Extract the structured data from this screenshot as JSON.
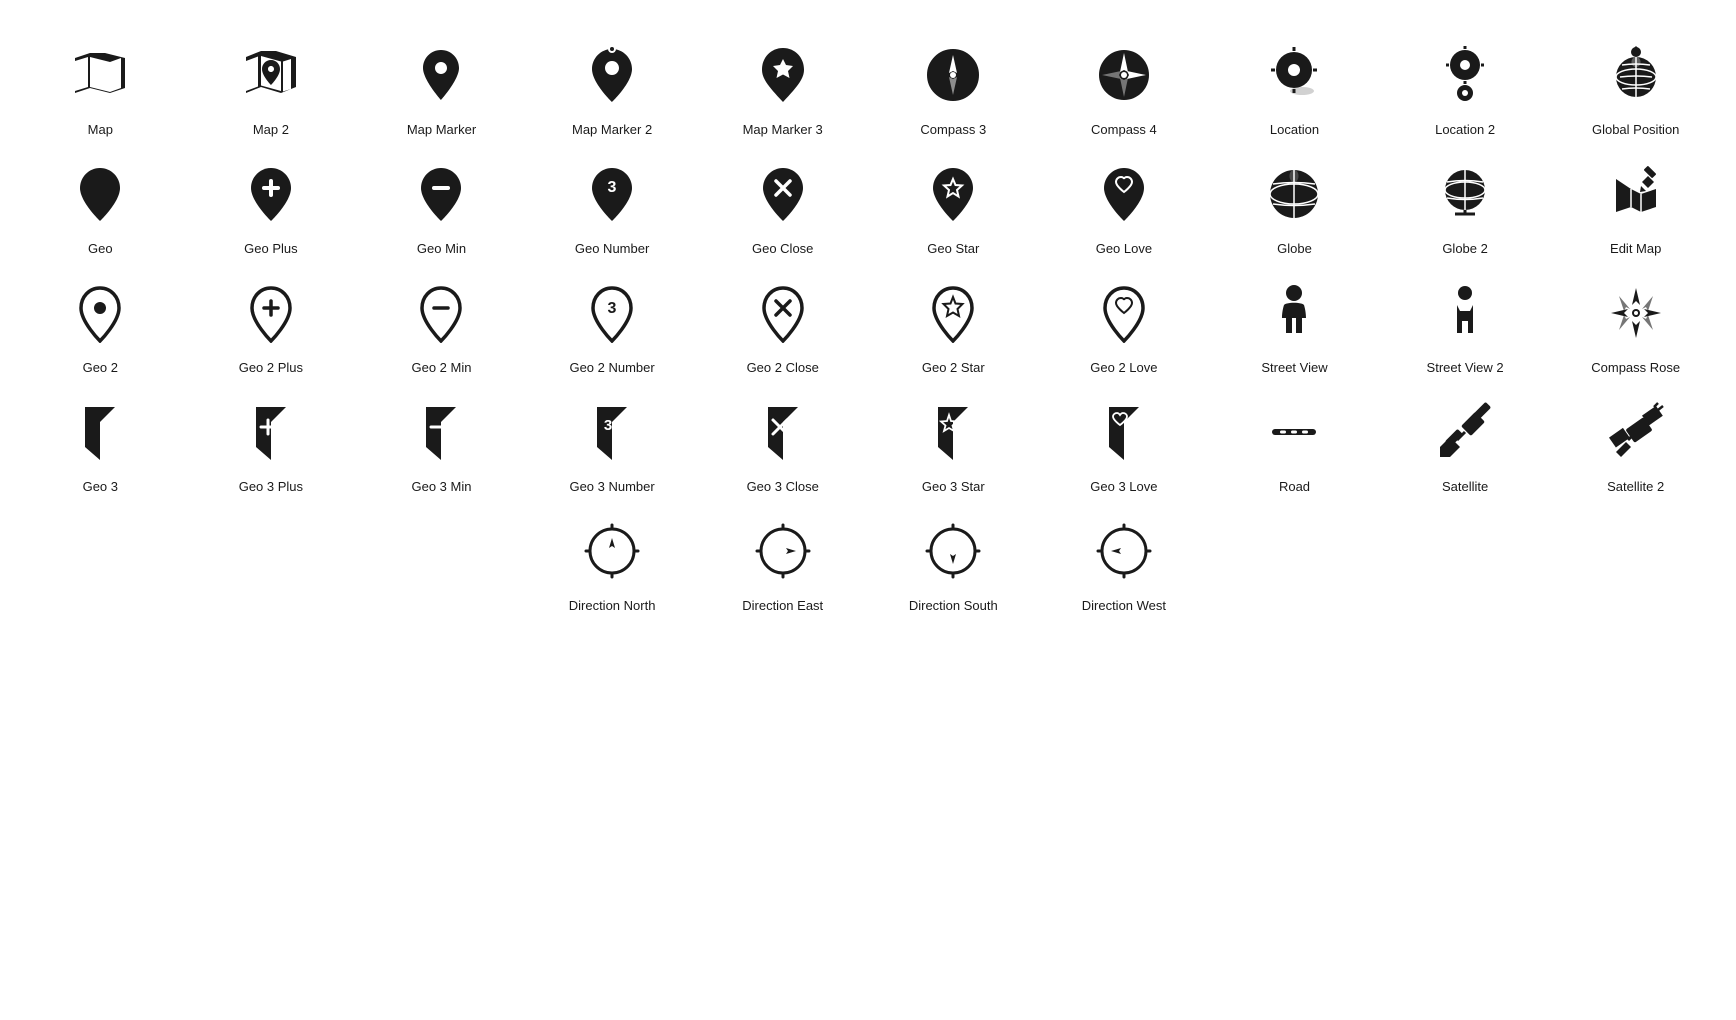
{
  "icons": {
    "row1": [
      {
        "name": "map",
        "label": "Map"
      },
      {
        "name": "map-2",
        "label": "Map 2"
      },
      {
        "name": "map-marker",
        "label": "Map Marker"
      },
      {
        "name": "map-marker-2",
        "label": "Map Marker 2"
      },
      {
        "name": "map-marker-3",
        "label": "Map Marker 3"
      },
      {
        "name": "compass-3",
        "label": "Compass 3"
      },
      {
        "name": "compass-4",
        "label": "Compass 4"
      },
      {
        "name": "location",
        "label": "Location"
      },
      {
        "name": "location-2",
        "label": "Location 2"
      },
      {
        "name": "global-position",
        "label": "Global Position"
      }
    ],
    "row2": [
      {
        "name": "geo",
        "label": "Geo"
      },
      {
        "name": "geo-plus",
        "label": "Geo Plus"
      },
      {
        "name": "geo-min",
        "label": "Geo Min"
      },
      {
        "name": "geo-number",
        "label": "Geo Number"
      },
      {
        "name": "geo-close",
        "label": "Geo Close"
      },
      {
        "name": "geo-star",
        "label": "Geo Star"
      },
      {
        "name": "geo-love",
        "label": "Geo Love"
      },
      {
        "name": "globe",
        "label": "Globe"
      },
      {
        "name": "globe-2",
        "label": "Globe 2"
      },
      {
        "name": "edit-map",
        "label": "Edit Map"
      }
    ],
    "row3": [
      {
        "name": "geo-2",
        "label": "Geo 2"
      },
      {
        "name": "geo-2-plus",
        "label": "Geo 2 Plus"
      },
      {
        "name": "geo-2-min",
        "label": "Geo 2 Min"
      },
      {
        "name": "geo-2-number",
        "label": "Geo 2 Number"
      },
      {
        "name": "geo-2-close",
        "label": "Geo 2 Close"
      },
      {
        "name": "geo-2-star",
        "label": "Geo 2 Star"
      },
      {
        "name": "geo-2-love",
        "label": "Geo 2 Love"
      },
      {
        "name": "street-view",
        "label": "Street View"
      },
      {
        "name": "street-view-2",
        "label": "Street View 2"
      },
      {
        "name": "compass-rose",
        "label": "Compass Rose"
      }
    ],
    "row4": [
      {
        "name": "geo-3",
        "label": "Geo 3"
      },
      {
        "name": "geo-3-plus",
        "label": "Geo 3 Plus"
      },
      {
        "name": "geo-3-min",
        "label": "Geo 3 Min"
      },
      {
        "name": "geo-3-number",
        "label": "Geo 3 Number"
      },
      {
        "name": "geo-3-close",
        "label": "Geo 3 Close"
      },
      {
        "name": "geo-3-star",
        "label": "Geo 3 Star"
      },
      {
        "name": "geo-3-love",
        "label": "Geo 3 Love"
      },
      {
        "name": "road",
        "label": "Road"
      },
      {
        "name": "satellite",
        "label": "Satellite"
      },
      {
        "name": "satellite-2",
        "label": "Satellite 2"
      }
    ],
    "row5": [
      {
        "name": "direction-north",
        "label": "Direction North"
      },
      {
        "name": "direction-east",
        "label": "Direction East"
      },
      {
        "name": "direction-south",
        "label": "Direction South"
      },
      {
        "name": "direction-west",
        "label": "Direction West"
      }
    ]
  }
}
